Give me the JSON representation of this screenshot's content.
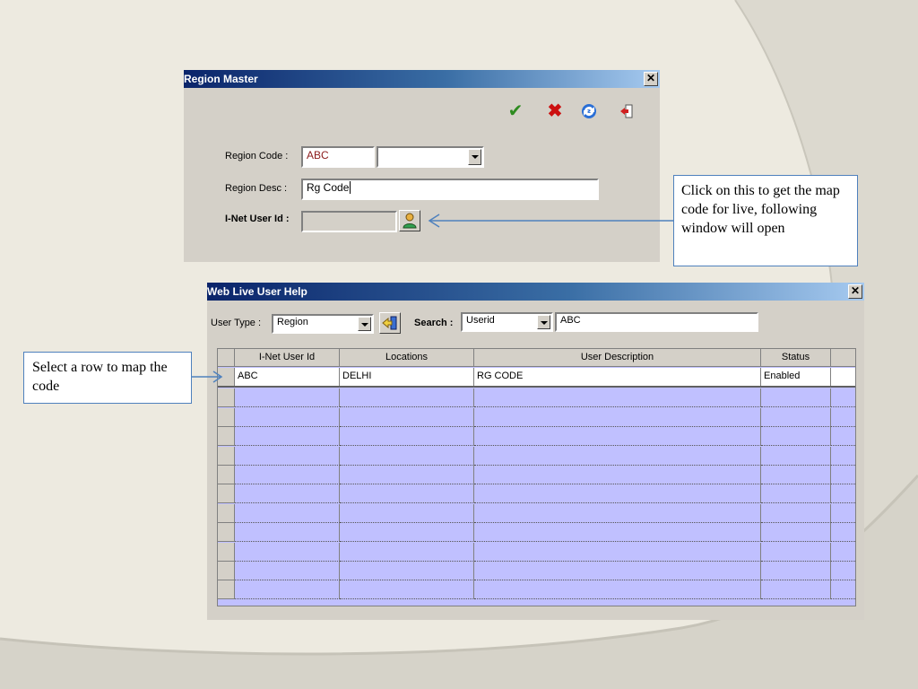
{
  "region_master": {
    "title": "Region Master",
    "close_glyph": "✕",
    "toolbar": {
      "ok_icon": "check-icon",
      "cancel_icon": "cross-icon",
      "refresh_icon": "refresh-icon",
      "exit_icon": "exit-door-icon"
    },
    "region_code_label": "Region Code :",
    "region_code_value": "ABC",
    "region_code_combo_value": "",
    "region_desc_label": "Region Desc :",
    "region_desc_value": "Rg Code",
    "inet_user_label": "I-Net  User Id :",
    "inet_user_value": "",
    "lookup_icon": "user-lookup-icon"
  },
  "callouts": {
    "map_code": "Click on this to get the map code for live, following window will open",
    "select_row": "Select  a row to map the code"
  },
  "web_live_help": {
    "title": "Web Live User Help",
    "close_glyph": "✕",
    "user_type_label": "User Type :",
    "user_type_value": "Region",
    "go_icon": "back-arrow-icon",
    "search_label": "Search :",
    "search_by_value": "Userid",
    "search_text": "ABC",
    "columns": [
      "I-Net User Id",
      "Locations",
      "User Description",
      "Status"
    ],
    "rows": [
      [
        "ABC",
        "DELHI",
        "RG CODE",
        "Enabled"
      ]
    ]
  },
  "colors": {
    "title_gradient_start": "#0a246a",
    "grid_background": "#c0c0ff",
    "callout_border": "#4f81bd",
    "check_green": "#2e8b20",
    "cross_red": "#cc1010"
  }
}
